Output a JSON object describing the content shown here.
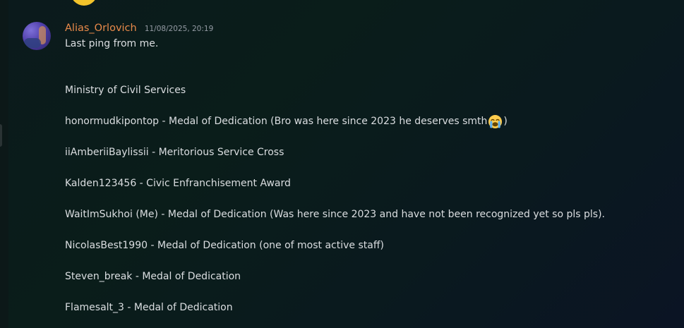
{
  "message": {
    "author": "Alias_Orlovich",
    "timestamp": "11/08/2025, 20:19",
    "first_line": "Last ping from me.",
    "heading": "Ministry of Civil Services",
    "entries": [
      {
        "text": "honormudkipontop - Medal of Dedication (Bro was here since 2023 he deserves smth",
        "emoji": "sob-emoji",
        "suffix": ")"
      },
      {
        "text": "iiAmberiiBaylissii - Meritorious Service Cross"
      },
      {
        "text": "Kalden123456 - Civic Enfranchisement Award"
      },
      {
        "text": "WaitImSukhoi (Me) - Medal of Dedication (Was here since 2023 and have not been recognized yet so pls pls)."
      },
      {
        "text": "NicolasBest1990 - Medal of Dedication (one of most active staff)"
      },
      {
        "text": "Steven_break - Medal of Dedication"
      },
      {
        "text": "Flamesalt_3 - Medal of Dedication"
      }
    ]
  },
  "colors": {
    "username": "#e98a4a",
    "text": "#dbdee1",
    "timestamp": "#949ba4"
  }
}
